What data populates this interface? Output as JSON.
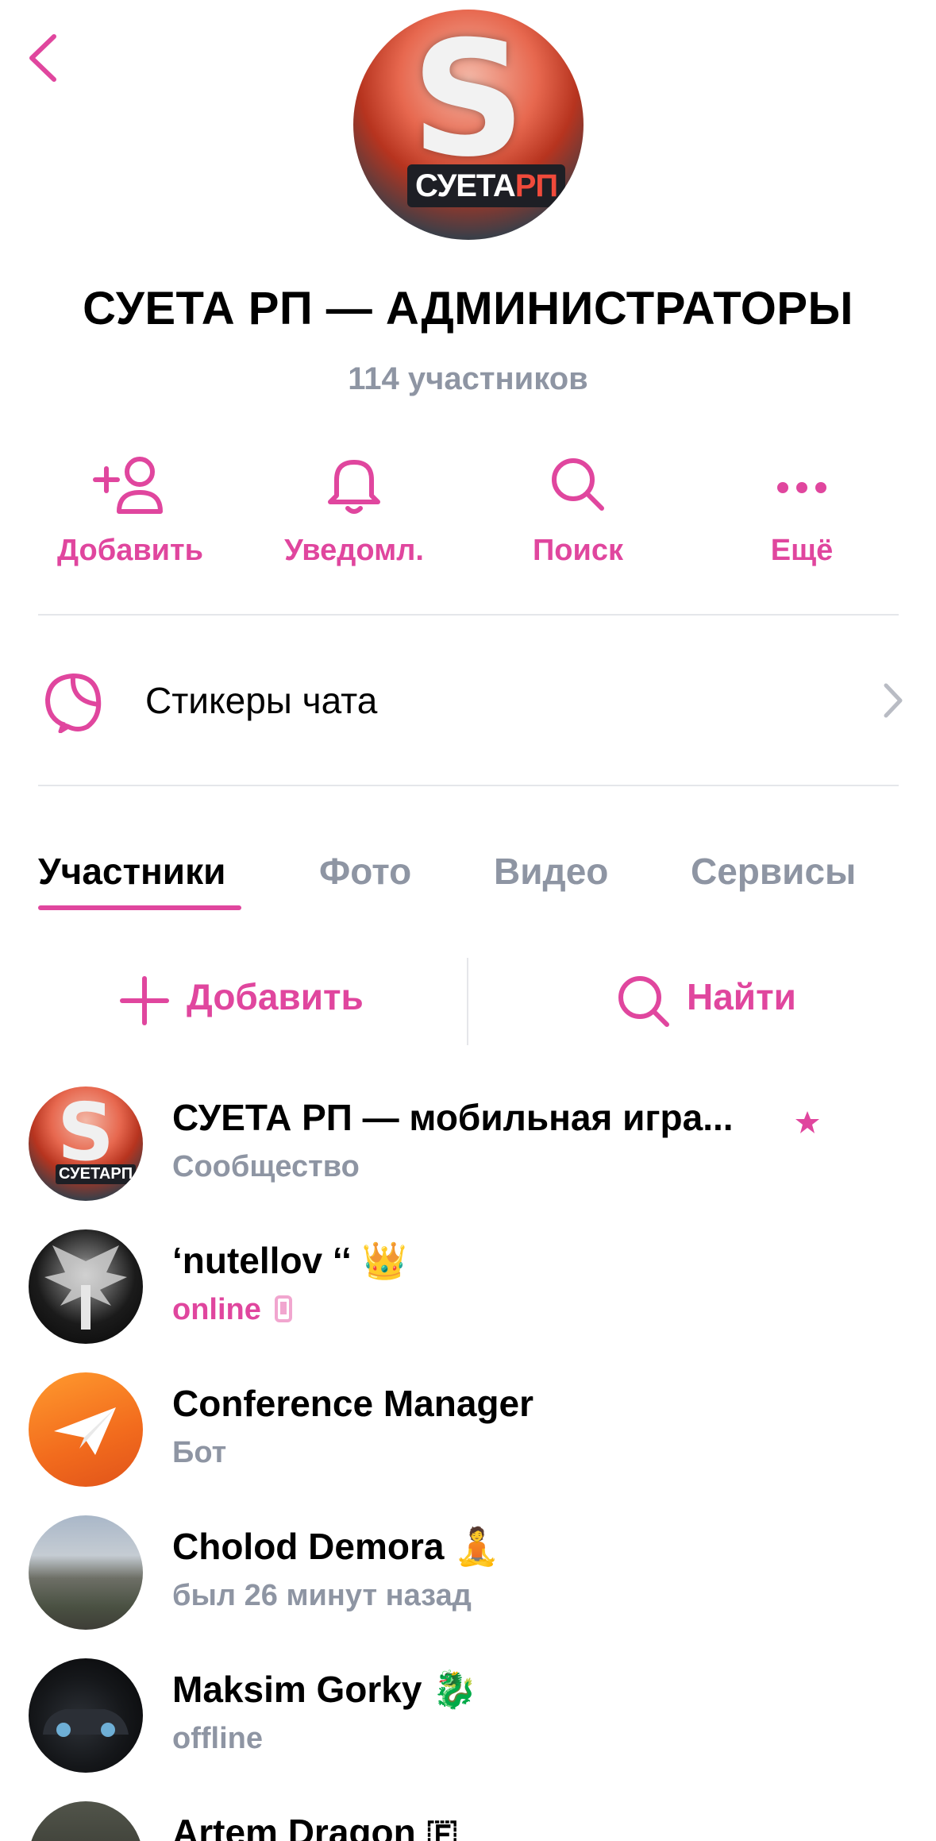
{
  "header": {
    "avatar_letter": "S",
    "avatar_brand_main": "СУЕТА",
    "avatar_brand_accent": "РП",
    "title": "СУЕТА РП — АДМИНИСТРАТОРЫ",
    "subtitle": "114 участников"
  },
  "actions": [
    {
      "label": "Добавить",
      "icon": "add-user-icon"
    },
    {
      "label": "Уведомл.",
      "icon": "bell-icon"
    },
    {
      "label": "Поиск",
      "icon": "search-icon"
    },
    {
      "label": "Ещё",
      "icon": "more-icon"
    }
  ],
  "stickers": {
    "label": "Стикеры чата",
    "icon": "sticker-icon"
  },
  "tabs": [
    {
      "label": "Участники",
      "active": true
    },
    {
      "label": "Фото",
      "active": false
    },
    {
      "label": "Видео",
      "active": false
    },
    {
      "label": "Сервисы",
      "active": false
    }
  ],
  "tools": {
    "add_label": "Добавить",
    "find_label": "Найти"
  },
  "members": [
    {
      "name": "СУЕТА РП — мобильная игра...",
      "status": "Сообщество",
      "badge": "star-icon",
      "avatar_brand": "СУЕТАРП"
    },
    {
      "name": "‘nutellov ‘‘ 👑",
      "status": "online",
      "status_icon": "mobile-icon"
    },
    {
      "name": "Conference Manager",
      "status": "Бот",
      "avatar_icon": "paper-plane-icon"
    },
    {
      "name": "Cholod Demora 🧘",
      "status": "был 26 минут назад"
    },
    {
      "name": "Maksim Gorky 🐉",
      "status": "offline"
    },
    {
      "name": "Artem Dragon 🇫",
      "status": ""
    }
  ],
  "colors": {
    "accent": "#e0469e",
    "muted": "#8e95a3",
    "divider": "#e5e6ea"
  }
}
